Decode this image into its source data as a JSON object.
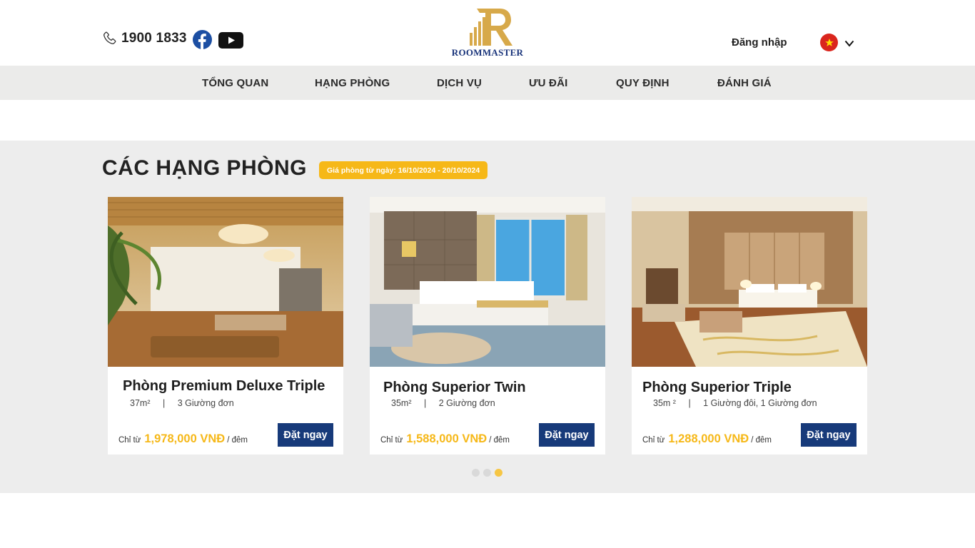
{
  "header": {
    "phone": "1900 1833",
    "brand": "ROOMMASTER",
    "login": "Đăng nhập",
    "language": "vi-flag",
    "icons": [
      "phone-icon",
      "facebook-icon",
      "youtube-icon",
      "chevron-down-icon"
    ]
  },
  "nav": {
    "items": [
      {
        "label": "TỔNG QUAN"
      },
      {
        "label": "HẠNG PHÒNG"
      },
      {
        "label": "DỊCH VỤ"
      },
      {
        "label": "ƯU ĐÃI"
      },
      {
        "label": "QUY ĐỊNH"
      },
      {
        "label": "ĐÁNH GIÁ"
      }
    ]
  },
  "rooms": {
    "title": "CÁC HẠNG PHÒNG",
    "price_range": "Giá phòng từ ngày: 16/10/2024 - 20/10/2024",
    "cards": [
      {
        "name": "Phòng Premium Deluxe Triple",
        "area": "37m²",
        "sep": "|",
        "beds": "3 Giường đơn",
        "from_label": "Chỉ từ",
        "price": "1,978,000 VNĐ",
        "per": "/ đêm",
        "book": "Đặt ngay"
      },
      {
        "name": "Phòng Superior Twin",
        "area": "35m²",
        "sep": "|",
        "beds": "2 Giường đơn",
        "from_label": "Chỉ từ",
        "price": "1,588,000 VNĐ",
        "per": "/ đêm",
        "book": "Đặt ngay"
      },
      {
        "name": "Phòng Superior Triple",
        "area": "35m ²",
        "sep": "|",
        "beds": "1 Giường đôi, 1 Giường đơn",
        "from_label": "Chỉ từ",
        "price": "1,288,000 VNĐ",
        "per": "/ đêm",
        "book": "Đặt ngay"
      }
    ],
    "carousel": {
      "pages": 3,
      "active": 3
    }
  },
  "colors": {
    "accent": "#f6b818",
    "navy": "#173a7a",
    "nav_bg": "#ebebea",
    "section_bg": "#ededed"
  }
}
